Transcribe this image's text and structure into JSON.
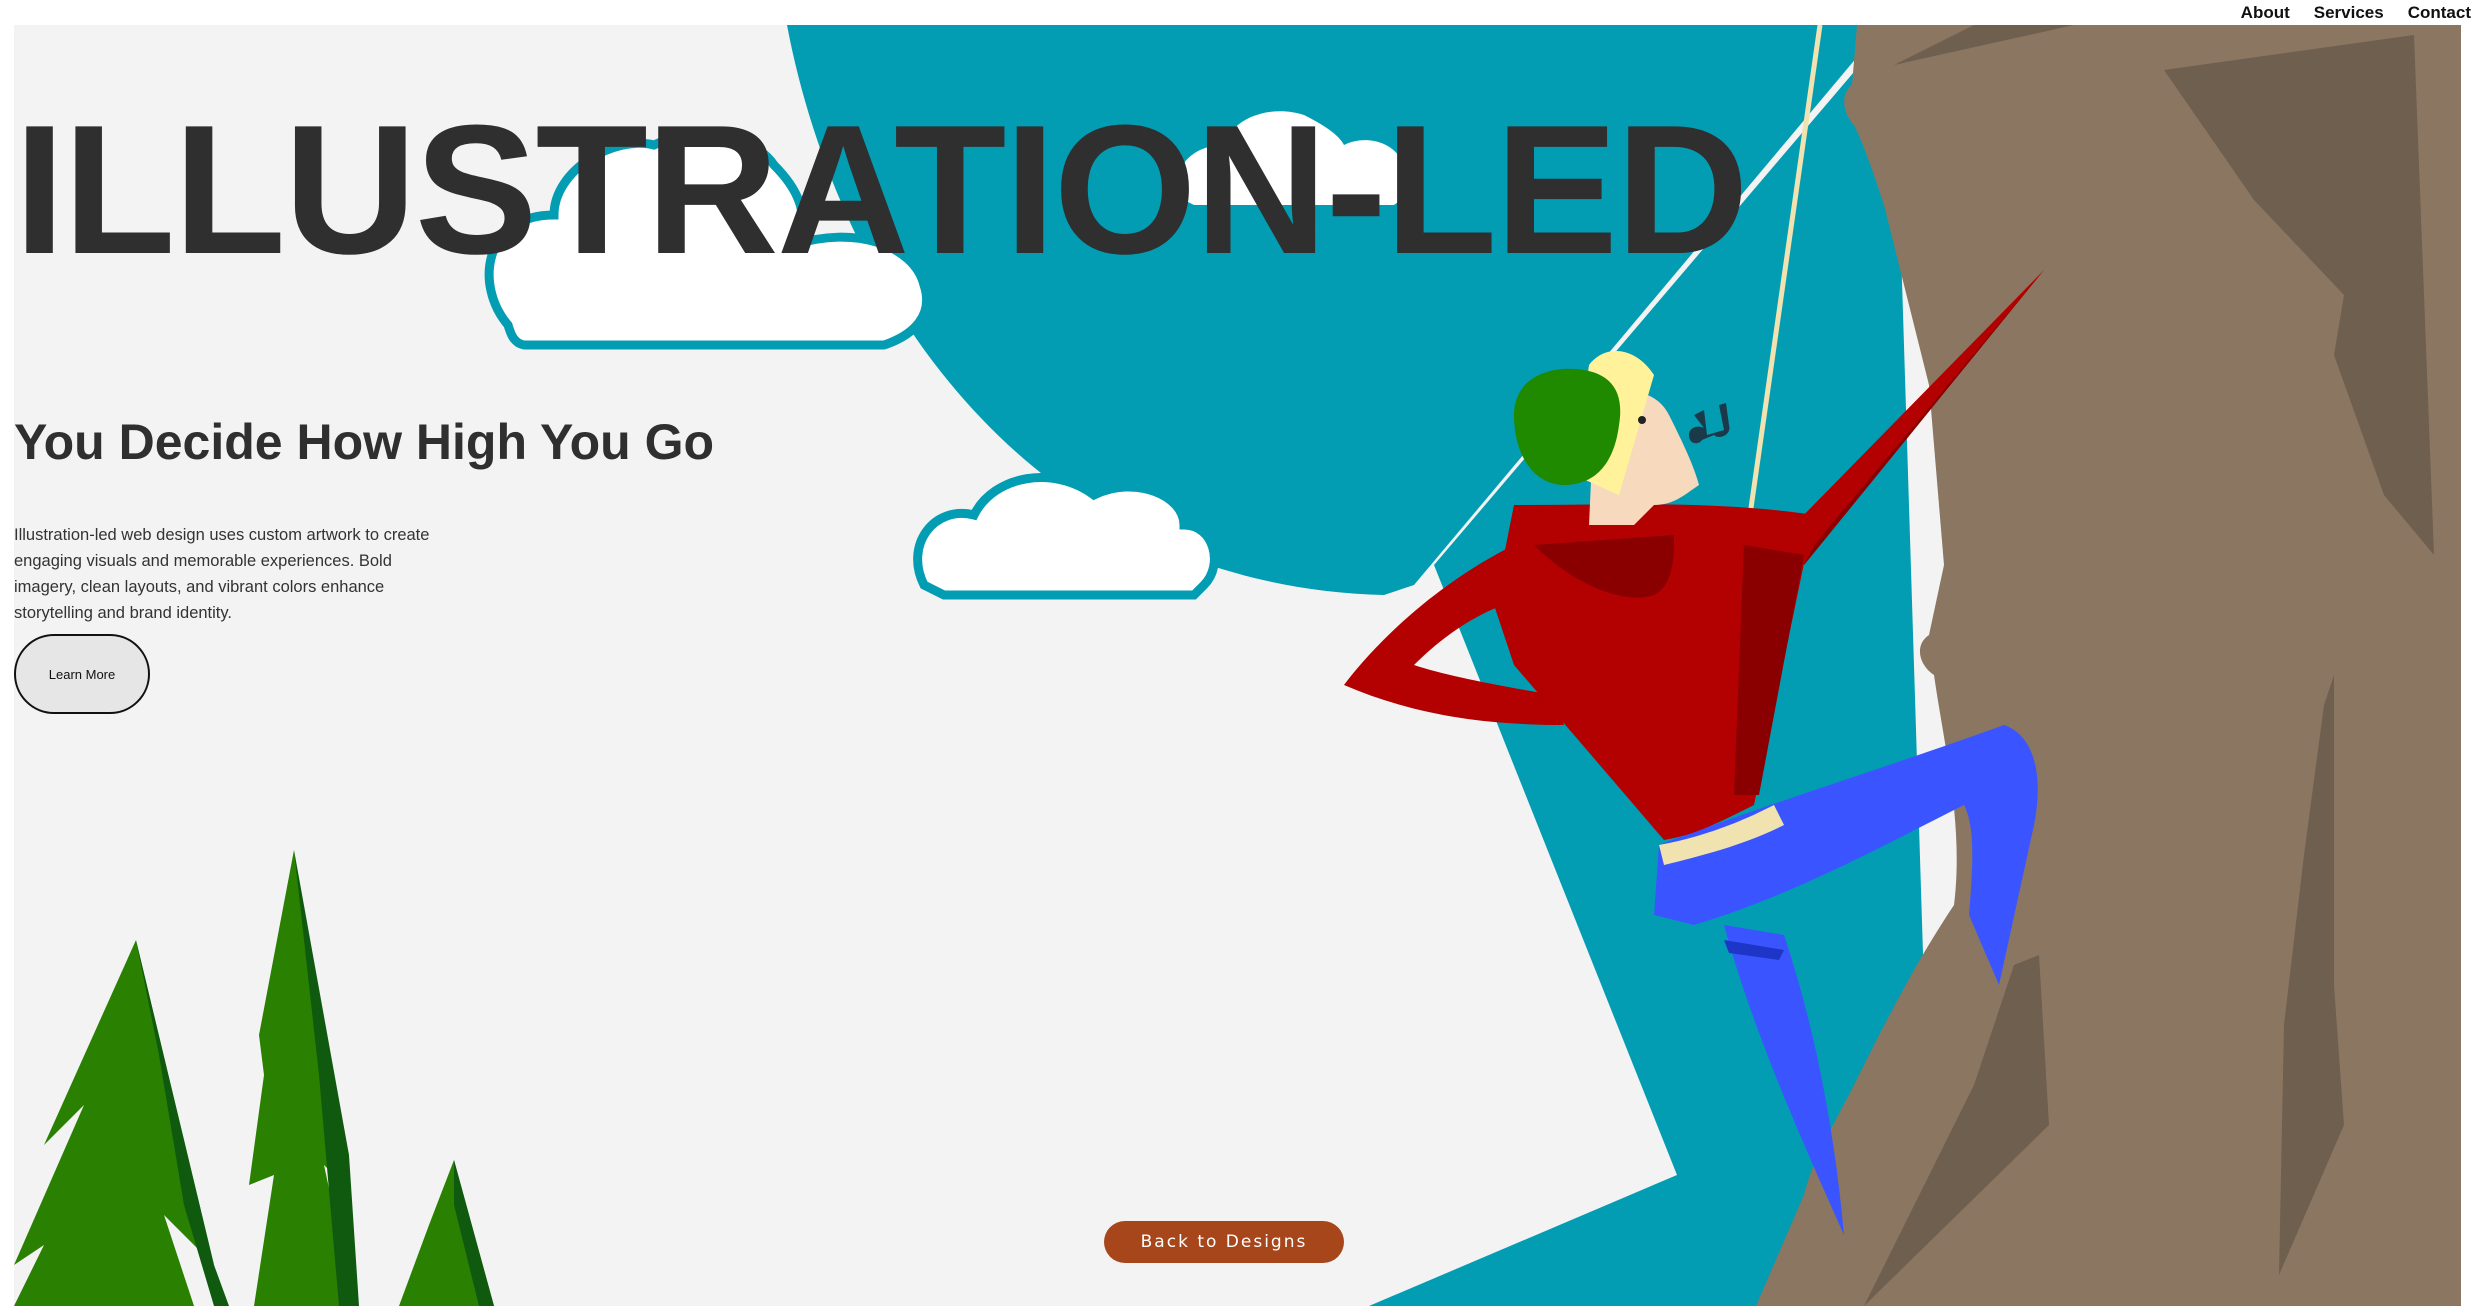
{
  "nav": {
    "about": "About",
    "services": "Services",
    "contact": "Contact"
  },
  "hero": {
    "title": "ILLUSTRATION-LED",
    "subtitle": "You Decide How High You Go",
    "description": "Illustration-led web design uses custom artwork to create engaging visuals and memorable experiences. Bold imagery, clean layouts, and vibrant colors enhance storytelling and brand identity.",
    "cta_label": "Learn More"
  },
  "footer": {
    "back_label": "Back to Designs"
  },
  "illustration": {
    "sky_color": "#039db3",
    "rock_color": "#8b7661",
    "rock_shadow_color": "#6f5f4f",
    "tree_color": "#2a8000",
    "sweater_color": "#b30000",
    "pants_color": "#3a55ff",
    "hat_color": "#1f8a00",
    "rope_color": "#f0e3b0",
    "cloud_color": "#ffffff",
    "accent_button_color": "#a8461b"
  }
}
